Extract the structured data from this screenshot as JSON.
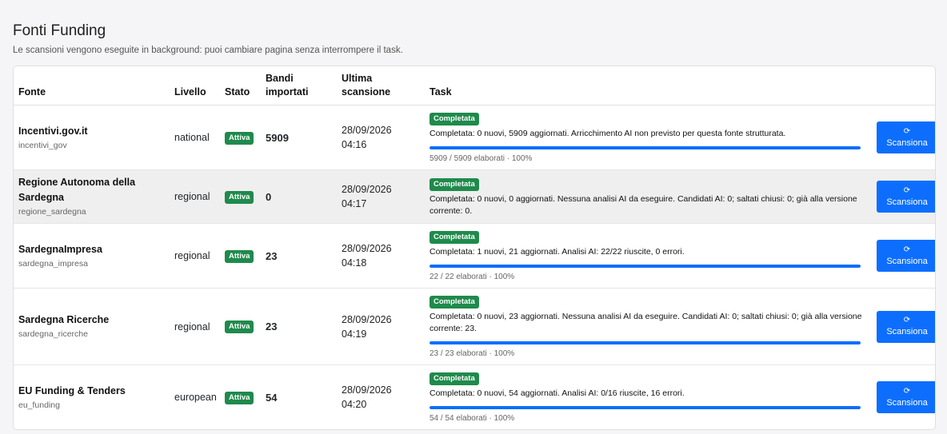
{
  "page": {
    "title": "Fonti Funding",
    "subtitle": "Le scansioni vengono eseguite in background: puoi cambiare pagina senza interrompere il task."
  },
  "table": {
    "headers": {
      "fonte": "Fonte",
      "livello": "Livello",
      "stato": "Stato",
      "bandi_1": "Bandi",
      "bandi_2": "importati",
      "ultima_1": "Ultima",
      "ultima_2": "scansione",
      "task": "Task"
    },
    "rows": [
      {
        "name": "Incentivi.gov.it",
        "key": "incentivi_gov",
        "livello": "national",
        "stato": "Attiva",
        "bandi": "5909",
        "date": "28/09/2026",
        "time": "04:16",
        "task_status": "Completata",
        "task_message": "Completata: 0 nuovi, 5909 aggiornati. Arricchimento AI non previsto per questa fonte strutturata.",
        "progress": 1.0,
        "progress_text": "5909 / 5909 elaborati · 100%",
        "button": "Scansiona"
      },
      {
        "name": "Regione Autonoma della Sardegna",
        "key": "regione_sardegna",
        "livello": "regional",
        "stato": "Attiva",
        "bandi": "0",
        "date": "28/09/2026",
        "time": "04:17",
        "task_status": "Completata",
        "task_message": "Completata: 0 nuovi, 0 aggiornati. Nessuna analisi AI da eseguire. Candidati AI: 0; saltati chiusi: 0; già alla versione corrente: 0.",
        "progress": null,
        "progress_text": "",
        "button": "Scansiona"
      },
      {
        "name": "SardegnaImpresa",
        "key": "sardegna_impresa",
        "livello": "regional",
        "stato": "Attiva",
        "bandi": "23",
        "date": "28/09/2026",
        "time": "04:18",
        "task_status": "Completata",
        "task_message": "Completata: 1 nuovi, 21 aggiornati. Analisi AI: 22/22 riuscite, 0 errori.",
        "progress": 1.0,
        "progress_text": "22 / 22 elaborati · 100%",
        "button": "Scansiona"
      },
      {
        "name": "Sardegna Ricerche",
        "key": "sardegna_ricerche",
        "livello": "regional",
        "stato": "Attiva",
        "bandi": "23",
        "date": "28/09/2026",
        "time": "04:19",
        "task_status": "Completata",
        "task_message": "Completata: 0 nuovi, 23 aggiornati. Nessuna analisi AI da eseguire. Candidati AI: 0; saltati chiusi: 0; già alla versione corrente: 23.",
        "progress": 1.0,
        "progress_text": "23 / 23 elaborati · 100%",
        "button": "Scansiona"
      },
      {
        "name": "EU Funding & Tenders",
        "key": "eu_funding",
        "livello": "european",
        "stato": "Attiva",
        "bandi": "54",
        "date": "28/09/2026",
        "time": "04:20",
        "task_status": "Completata",
        "task_message": "Completata: 0 nuovi, 54 aggiornati. Analisi AI: 0/16 riuscite, 16 errori.",
        "progress": 1.0,
        "progress_text": "54 / 54 elaborati · 100%",
        "button": "Scansiona"
      }
    ]
  },
  "icons": {
    "scan": "refresh-icon"
  },
  "colors": {
    "accent": "#0d6efd",
    "success": "#1f8a4c",
    "row_highlight": "#efefef"
  }
}
